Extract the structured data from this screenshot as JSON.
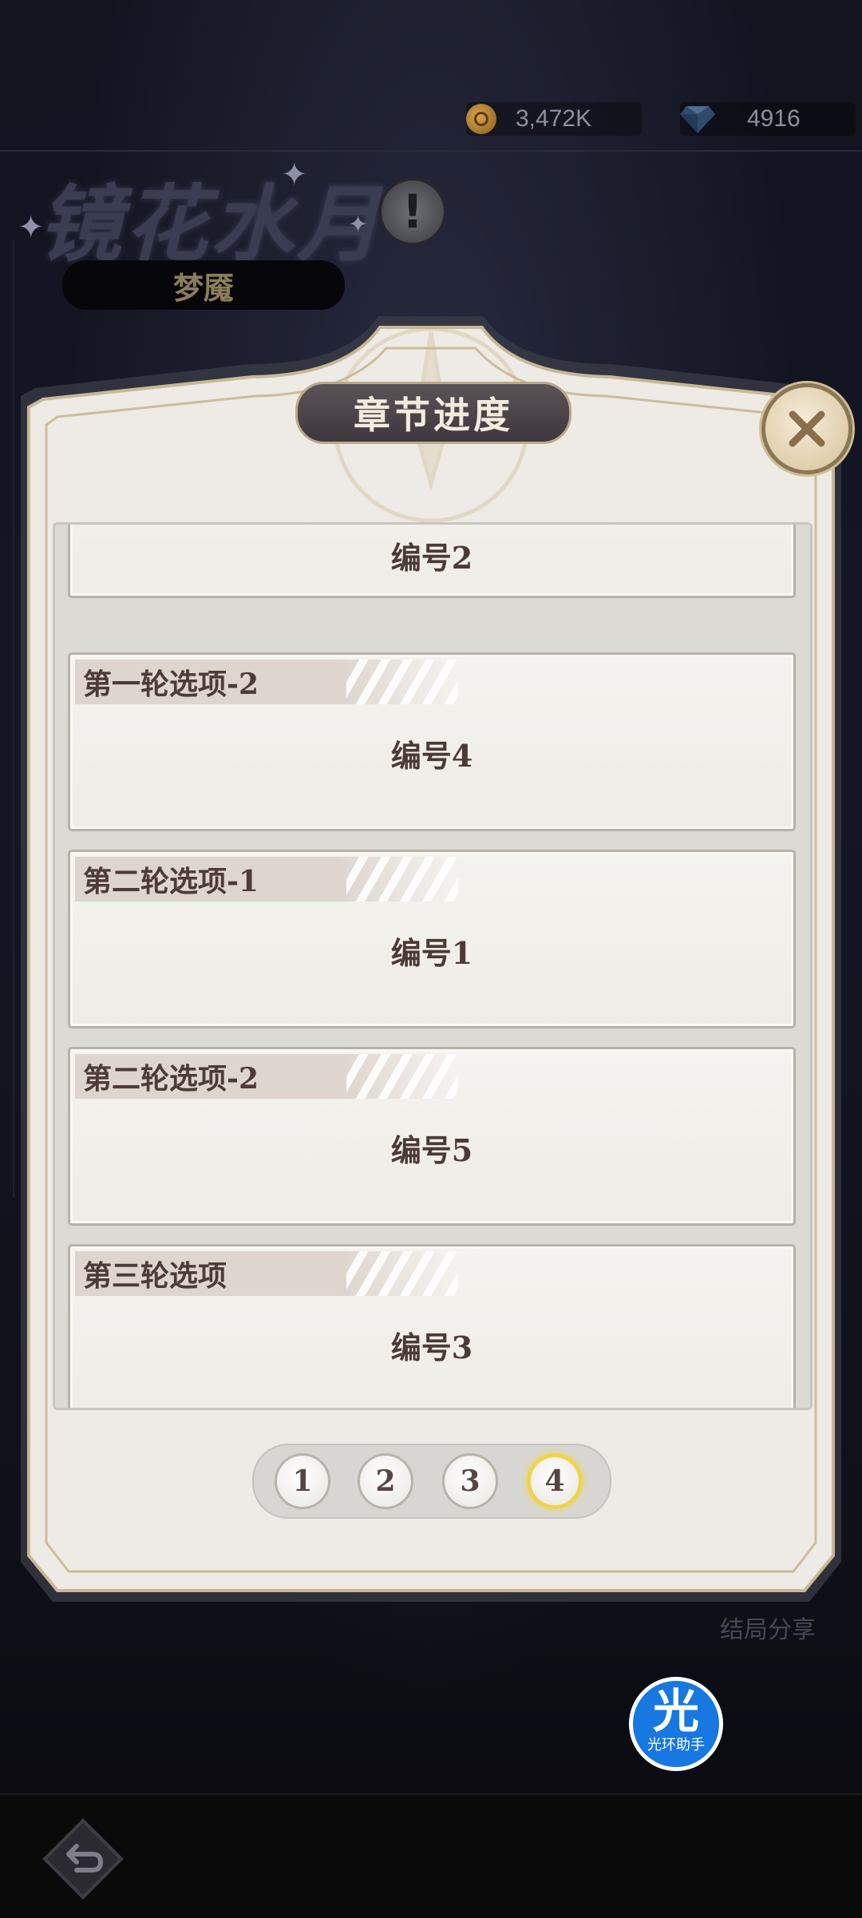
{
  "currencies": {
    "coin_value": "3,472K",
    "gem_value": "4916",
    "coin_icon": "gold-coin-icon",
    "gem_icon": "blue-diamond-icon"
  },
  "chapter": {
    "title": "镜花水月",
    "subtitle": "梦魇",
    "info_icon": "exclamation-icon"
  },
  "modal": {
    "title": "章节进度",
    "close_icon": "close-x-icon",
    "cards": [
      {
        "tag": "",
        "value": "编号2"
      },
      {
        "tag": "第一轮选项-2",
        "value": "编号4"
      },
      {
        "tag": "第二轮选项-1",
        "value": "编号1"
      },
      {
        "tag": "第二轮选项-2",
        "value": "编号5"
      },
      {
        "tag": "第三轮选项",
        "value": "编号3"
      }
    ],
    "pages": [
      "1",
      "2",
      "3",
      "4"
    ],
    "active_page": "4"
  },
  "share_label": "结局分享",
  "assistant": {
    "big": "光",
    "small": "光环助手"
  },
  "back_icon": "back-arrow-icon",
  "colors": {
    "active_page_ring": "#f1d34c",
    "assistant_blue": "#1678e0",
    "card_text": "#4b3a36"
  }
}
